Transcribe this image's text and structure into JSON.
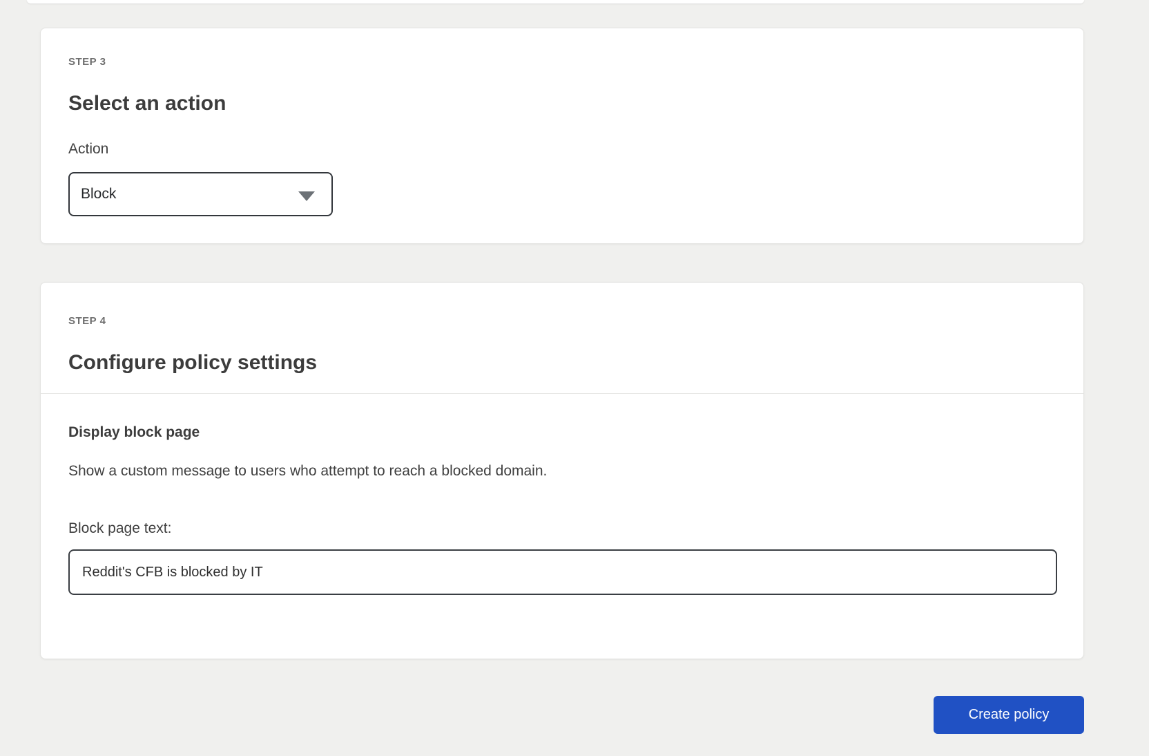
{
  "step3": {
    "step_label": "STEP 3",
    "title": "Select an action",
    "action_label": "Action",
    "action_selected_value": "Block"
  },
  "step4": {
    "step_label": "STEP 4",
    "title": "Configure policy settings",
    "section_title": "Display block page",
    "section_description": "Show a custom message to users who attempt to reach a blocked domain.",
    "block_page_text_label": "Block page text:",
    "block_page_text_value": "Reddit's CFB is blocked by IT"
  },
  "footer": {
    "create_button_label": "Create policy"
  },
  "icons": {
    "action_select_caret": "chevron-down-icon"
  },
  "colors": {
    "page_background": "#f0f0ee",
    "card_background": "#ffffff",
    "primary_button_blue": "#2051c4",
    "heading_text": "#3c3c3c",
    "step_label_text": "#6e6e6e",
    "input_border": "#33373c"
  }
}
